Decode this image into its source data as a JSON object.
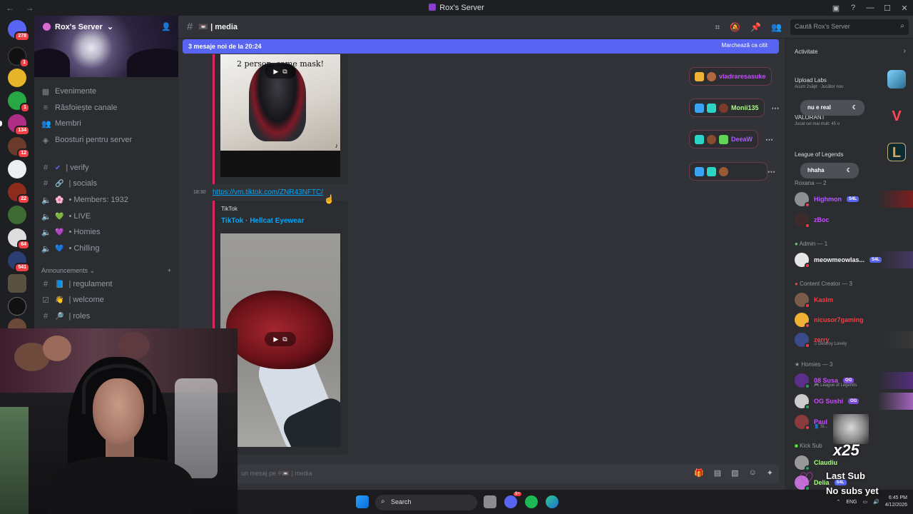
{
  "window": {
    "title": "Rox's Server"
  },
  "server": {
    "name": "Rox's Server",
    "nav_items": [
      {
        "label": "Evenimente",
        "icon": "calendar-icon"
      },
      {
        "label": "Răsfoiește canale",
        "icon": "browse-icon"
      },
      {
        "label": "Membri",
        "icon": "members-icon"
      },
      {
        "label": "Boosturi pentru server",
        "icon": "boost-icon"
      }
    ],
    "channels": [
      {
        "label": "| verify",
        "type": "text",
        "emoji": "✔"
      },
      {
        "label": "| socials",
        "type": "text",
        "emoji": "🔗"
      },
      {
        "label": "• Members: 1932",
        "type": "voice",
        "emoji": "🌸"
      },
      {
        "label": "• LIVE",
        "type": "voice",
        "emoji": "💚"
      },
      {
        "label": "• Homies",
        "type": "voice",
        "emoji": "💜"
      },
      {
        "label": "• Chilling",
        "type": "voice",
        "emoji": "💙"
      }
    ],
    "category": "Announcements",
    "announcement_channels": [
      {
        "label": "| regulament",
        "emoji": "📘"
      },
      {
        "label": "| welcome",
        "emoji": "👋"
      },
      {
        "label": "| roles",
        "emoji": "🔎"
      }
    ],
    "rail_badges": [
      "278",
      "1",
      "1",
      "1",
      "134",
      "12",
      "22",
      "64",
      "541"
    ]
  },
  "channel": {
    "name": "| media",
    "emoji": "📼"
  },
  "search": {
    "placeholder": "Caută Rox's Server"
  },
  "new_messages_bar": {
    "label": "3 mesaje noi de la 20:24",
    "mark": "Marchează ca citit"
  },
  "messages": {
    "video1_caption": "2 person, same mask!",
    "time": "18:30",
    "link": "https://vm.tiktok.com/ZNR43NFTC/",
    "embed_provider": "TikTok",
    "embed_title": "TikTok · Hellcat Eyewear"
  },
  "floating_buttons": [
    {
      "label": "vladraresasuke",
      "color": "#c94bff"
    },
    {
      "label": "Monii135",
      "color": "#a6ff7a"
    },
    {
      "label": "DeeaW",
      "color": "#b05cff"
    },
    {
      "label": "",
      "color": "#ff3f7a"
    }
  ],
  "activities": [
    {
      "title": "Activitate",
      "sub": ""
    },
    {
      "title": "Upload Labs",
      "sub": "Acum 2săpt · Jucător nou"
    },
    {
      "title": "VALORANT",
      "sub": "Jucat cel mai mult: 45 o"
    },
    {
      "title": "League of Legends",
      "sub": ""
    }
  ],
  "hover_chips": [
    "nu e real",
    "hhaha"
  ],
  "groups": {
    "roxana": "Roxana — 2",
    "admin": "Admin — 1",
    "content": "Content Creator — 3",
    "homies": "Homies — 3",
    "kick": "Kick Sub"
  },
  "members": {
    "roxana": [
      {
        "name": "Highmon",
        "tag": "S4L",
        "color": "#b15cff"
      },
      {
        "name": "zBoc",
        "tag": "",
        "color": "#c94bff"
      }
    ],
    "admin": [
      {
        "name": "meowmeowlas...",
        "tag": "S4L",
        "color": "#f2f3f5"
      }
    ],
    "content": [
      {
        "name": "Kasim",
        "tag": "",
        "color": "#f23f43",
        "activity": ""
      },
      {
        "name": "nicusor7gaming",
        "tag": "",
        "color": "#f23f43",
        "activity": ""
      },
      {
        "name": "zerry",
        "tag": "",
        "color": "#f23f43",
        "activity": "Destroy Lonely"
      }
    ],
    "homies": [
      {
        "name": "08 Susa",
        "tag": "OG",
        "color": "#c94bff",
        "activity": "League of Legends"
      },
      {
        "name": "OG Sushi",
        "tag": "OG",
        "color": "#c94bff",
        "activity": ""
      },
      {
        "name": "Paul",
        "tag": "",
        "color": "#c94bff",
        "activity": "Si..."
      }
    ],
    "kick": [
      {
        "name": "Claudiu",
        "tag": "",
        "color": "#a6ff7a"
      },
      {
        "name": "Delia",
        "tag": "S4L",
        "color": "#a6ff7a"
      }
    ]
  },
  "composer": {
    "placeholder": "un mesaj pe #📼 | media"
  },
  "taskbar": {
    "search": "Search",
    "lang": "ENG",
    "time": "6:45 PM",
    "date": "4/12/2026",
    "discord_badge": "9+"
  },
  "overlay": {
    "multiplier": "x25",
    "line1": "Last Sub",
    "line2": "No subs yet"
  }
}
